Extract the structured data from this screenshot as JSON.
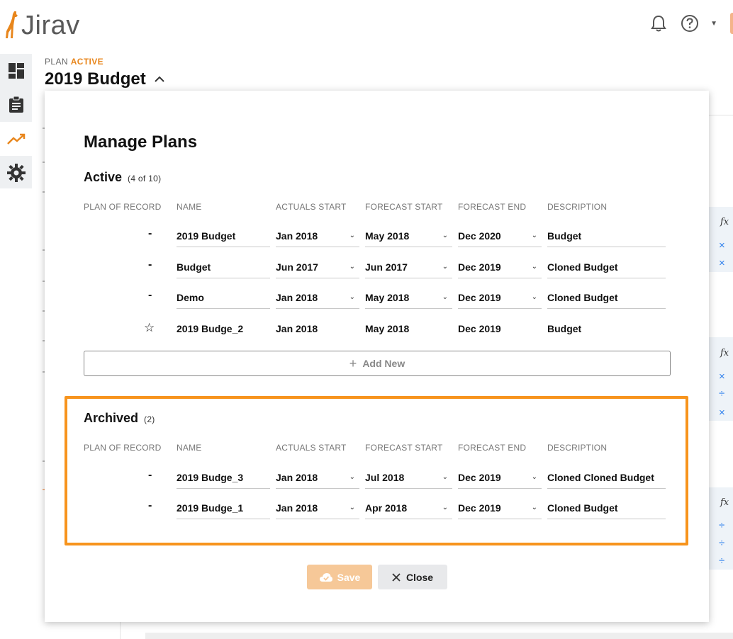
{
  "app": {
    "logo_text": "Jirav",
    "colors": {
      "accent": "#e8861c",
      "highlight_border": "#f7941d",
      "save_disabled": "#f6c898",
      "link_blue": "#2f80ed"
    }
  },
  "topbar": {
    "icons": [
      "bell-icon",
      "help-icon",
      "chevron-down-icon"
    ]
  },
  "sidebar": {
    "items": [
      {
        "icon": "dashboard-icon",
        "active": false
      },
      {
        "icon": "clipboard-icon",
        "active": false
      },
      {
        "icon": "trending-up-icon",
        "active": true
      },
      {
        "icon": "gear-icon",
        "active": false
      }
    ]
  },
  "header": {
    "plan_prefix": "PLAN",
    "plan_status": "ACTIVE",
    "plan_name": "2019 Budget",
    "chevron": "^"
  },
  "background": {
    "fx_label": "fx",
    "symbols": [
      "×",
      "×",
      "×",
      "÷",
      "×",
      "÷",
      "÷",
      "÷"
    ]
  },
  "modal": {
    "title": "Manage Plans",
    "columns": [
      "PLAN OF RECORD",
      "NAME",
      "ACTUALS START",
      "FORECAST START",
      "FORECAST END",
      "DESCRIPTION"
    ],
    "active": {
      "label": "Active",
      "count": "(4 of 10)",
      "rows": [
        {
          "record": "-",
          "name": "2019 Budget",
          "actuals_start": "Jan 2018",
          "forecast_start": "May 2018",
          "forecast_end": "Dec 2020",
          "description": "Budget",
          "editable": true
        },
        {
          "record": "-",
          "name": "Budget",
          "actuals_start": "Jun 2017",
          "forecast_start": "Jun 2017",
          "forecast_end": "Dec 2019",
          "description": "Cloned Budget",
          "editable": true
        },
        {
          "record": "-",
          "name": "Demo",
          "actuals_start": "Jan 2018",
          "forecast_start": "May 2018",
          "forecast_end": "Dec 2019",
          "description": "Cloned Budget",
          "editable": true
        },
        {
          "record": "☆",
          "name": "2019 Budge_2",
          "actuals_start": "Jan 2018",
          "forecast_start": "May 2018",
          "forecast_end": "Dec 2019",
          "description": "Budget",
          "editable": false
        }
      ]
    },
    "add_new_label": "Add New",
    "archived": {
      "label": "Archived",
      "count": "(2)",
      "rows": [
        {
          "record": "-",
          "name": "2019 Budge_3",
          "actuals_start": "Jan 2018",
          "forecast_start": "Jul 2018",
          "forecast_end": "Dec 2019",
          "description": "Cloned Cloned Budget"
        },
        {
          "record": "-",
          "name": "2019 Budge_1",
          "actuals_start": "Jan 2018",
          "forecast_start": "Apr 2018",
          "forecast_end": "Dec 2019",
          "description": "Cloned Budget"
        }
      ]
    },
    "save_label": "Save",
    "close_label": "Close"
  }
}
